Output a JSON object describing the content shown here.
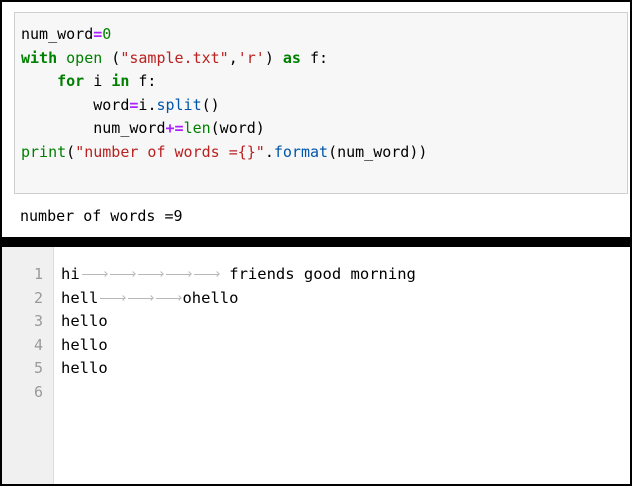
{
  "notebook": {
    "code_lines": [
      [
        {
          "t": "num_word",
          "c": ""
        },
        {
          "t": "=",
          "c": "op"
        },
        {
          "t": "0",
          "c": "num"
        }
      ],
      [
        {
          "t": "with",
          "c": "kw"
        },
        {
          "t": " ",
          "c": ""
        },
        {
          "t": "open",
          "c": "bi"
        },
        {
          "t": " (",
          "c": ""
        },
        {
          "t": "\"sample.txt\"",
          "c": "str"
        },
        {
          "t": ",",
          "c": ""
        },
        {
          "t": "'r'",
          "c": "str"
        },
        {
          "t": ") ",
          "c": ""
        },
        {
          "t": "as",
          "c": "kw"
        },
        {
          "t": " f:",
          "c": ""
        }
      ],
      [
        {
          "t": "    ",
          "c": ""
        },
        {
          "t": "for",
          "c": "kw"
        },
        {
          "t": " i ",
          "c": ""
        },
        {
          "t": "in",
          "c": "kw"
        },
        {
          "t": " f:",
          "c": ""
        }
      ],
      [
        {
          "t": "        word",
          "c": ""
        },
        {
          "t": "=",
          "c": "op"
        },
        {
          "t": "i",
          "c": ""
        },
        {
          "t": ".",
          "c": ""
        },
        {
          "t": "split",
          "c": "meth"
        },
        {
          "t": "()",
          "c": ""
        }
      ],
      [
        {
          "t": "        num_word",
          "c": ""
        },
        {
          "t": "+=",
          "c": "op"
        },
        {
          "t": "len",
          "c": "bi"
        },
        {
          "t": "(word)",
          "c": ""
        }
      ],
      [
        {
          "t": "print",
          "c": "bi"
        },
        {
          "t": "(",
          "c": ""
        },
        {
          "t": "\"number of words ={}\"",
          "c": "str"
        },
        {
          "t": ".",
          "c": ""
        },
        {
          "t": "format",
          "c": "meth"
        },
        {
          "t": "(num_word))",
          "c": ""
        }
      ]
    ],
    "output": "number of words =9"
  },
  "editor": {
    "line_numbers": [
      "1",
      "2",
      "3",
      "4",
      "5",
      "6"
    ],
    "lines": [
      [
        {
          "t": "hi",
          "tab": 0
        },
        {
          "t": "",
          "tab": 3
        },
        {
          "t": "",
          "tab": 3
        },
        {
          "t": "",
          "tab": 3
        },
        {
          "t": "",
          "tab": 3
        },
        {
          "t": "",
          "tab": 3
        },
        {
          "t": " friends good morning",
          "tab": 0
        }
      ],
      [
        {
          "t": "hell",
          "tab": 0
        },
        {
          "t": "",
          "tab": 3
        },
        {
          "t": "",
          "tab": 3
        },
        {
          "t": "",
          "tab": 3
        },
        {
          "t": "ohello",
          "tab": 0
        }
      ],
      [
        {
          "t": "hello",
          "tab": 0
        }
      ],
      [
        {
          "t": "hello",
          "tab": 0
        }
      ],
      [
        {
          "t": "hello",
          "tab": 0
        }
      ],
      []
    ]
  },
  "colors": {
    "keyword": "#008000",
    "operator": "#aa22ff",
    "string": "#ba2121",
    "method": "#0055aa",
    "gutter_bg": "#f0f0f0",
    "line_number": "#999999"
  }
}
